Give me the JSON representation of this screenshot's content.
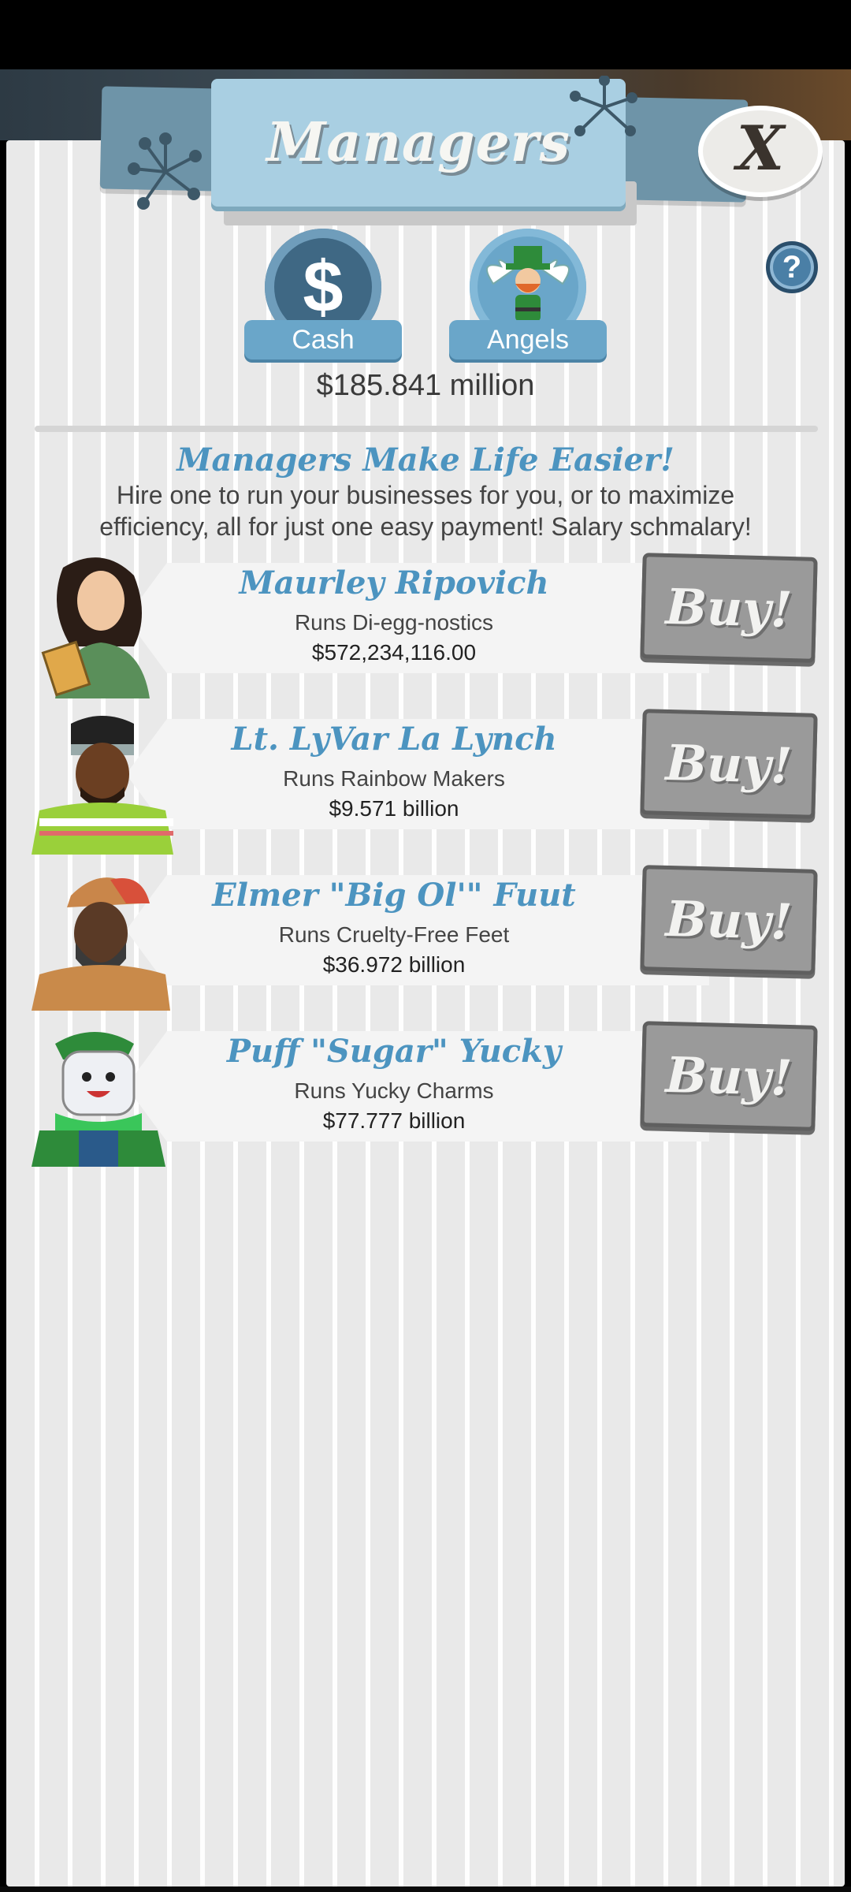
{
  "header": {
    "title": "Managers",
    "close_label": "X",
    "help_label": "?"
  },
  "tabs": [
    {
      "label": "Cash",
      "icon": "dollar-icon",
      "glyph": "$"
    },
    {
      "label": "Angels",
      "icon": "leprechaun-angel-icon"
    }
  ],
  "cash_amount": "$185.841 million",
  "intro": {
    "title": "Managers Make Life Easier!",
    "text": "Hire one to run your businesses for you, or to maximize efficiency, all for just one easy payment! Salary schmalary!"
  },
  "managers": [
    {
      "name": "Maurley Ripovich",
      "runs": "Runs Di-egg-nostics",
      "cost": "$572,234,116.00",
      "buy_label": "Buy!"
    },
    {
      "name": "Lt. LyVar La Lynch",
      "runs": "Runs Rainbow Makers",
      "cost": "$9.571 billion",
      "buy_label": "Buy!"
    },
    {
      "name": "Elmer \"Big Ol'\" Fuut",
      "runs": "Runs Cruelty-Free Feet",
      "cost": "$36.972 billion",
      "buy_label": "Buy!"
    },
    {
      "name": "Puff \"Sugar\" Yucky",
      "runs": "Runs Yucky Charms",
      "cost": "$77.777 billion",
      "buy_label": "Buy!"
    }
  ],
  "colors": {
    "accent_blue": "#4c94c0",
    "tab_blue": "#6aa6c9",
    "buy_gray": "#9a9a9a"
  }
}
